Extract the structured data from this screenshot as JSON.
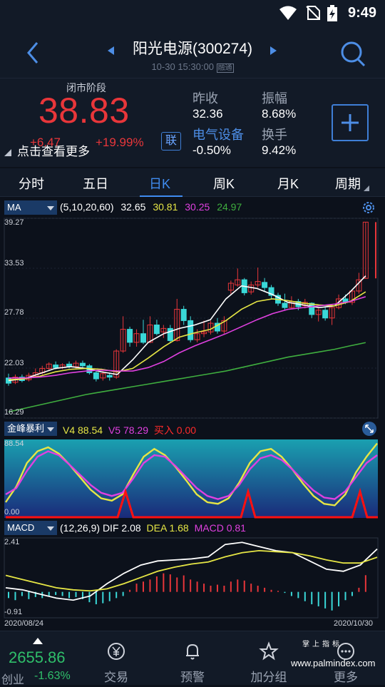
{
  "status_bar": {
    "time": "9:49"
  },
  "header": {
    "title": "阳光电源(300274)",
    "subtitle": "10-30 15:30:00",
    "subtitle_badge": "融通"
  },
  "quote": {
    "phase": "闭市阶段",
    "price": "38.83",
    "change": "+6.47",
    "change_pct": "+19.99%",
    "more_label": "点击查看更多",
    "link_badge": "联",
    "prev_close_label": "昨收",
    "prev_close": "32.36",
    "amplitude_label": "振幅",
    "amplitude": "8.68%",
    "industry": "电气设备",
    "industry_change": "-0.50%",
    "turnover_label": "换手",
    "turnover": "9.42%"
  },
  "tabs": [
    {
      "label": "分时"
    },
    {
      "label": "五日"
    },
    {
      "label": "日K"
    },
    {
      "label": "周K"
    },
    {
      "label": "月K"
    },
    {
      "label": "周期"
    }
  ],
  "active_tab": "日K",
  "ma_panel": {
    "selector": "MA",
    "params": "(5,10,20,60)",
    "ma5": "32.65",
    "ma10": "30.81",
    "ma20": "30.25",
    "ma60": "24.97",
    "axis_labels": [
      "39.27",
      "33.53",
      "27.78",
      "22.03",
      "16.29"
    ]
  },
  "jfbl_panel": {
    "selector": "金峰暴利",
    "v4_label": "V4",
    "v4": "88.54",
    "v5_label": "V5",
    "v5": "78.29",
    "buy_label": "买入",
    "buy": "0.00",
    "axis_labels": [
      "88.54",
      "0.00"
    ]
  },
  "macd_panel": {
    "selector": "MACD",
    "params": "(12,26,9)",
    "dif_label": "DIF",
    "dif": "2.08",
    "dea_label": "DEA",
    "dea": "1.68",
    "macd_label": "MACD",
    "macd": "0.81",
    "axis_labels": [
      "2.41",
      "-0.91"
    ],
    "date_start": "2020/08/24",
    "date_end": "2020/10/30"
  },
  "bottom_nav": {
    "index_value": "2655.86",
    "index_name": "创业",
    "index_pct": "-1.63%",
    "items": [
      {
        "label": "交易",
        "icon": "yuan-exchange-icon"
      },
      {
        "label": "预警",
        "icon": "bell-icon"
      },
      {
        "label": "加分组",
        "icon": "star-icon"
      },
      {
        "label": "更多",
        "icon": "more-dots-icon"
      }
    ]
  },
  "watermark": {
    "top": "掌上指标",
    "bottom": "www.palmindex.com"
  },
  "colors": {
    "up": "#e8363a",
    "down": "#3ad8d8",
    "accent": "#3f8cf0",
    "ma5": "#ffffff",
    "ma10": "#e6e645",
    "ma20": "#e040e0",
    "ma60": "#3fae3f",
    "index_green": "#2fbf6a"
  }
}
